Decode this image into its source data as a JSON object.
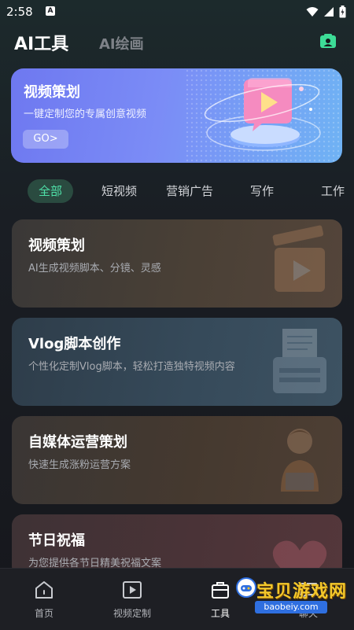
{
  "status_bar": {
    "time": "2:58",
    "notif_badge": "A"
  },
  "header": {
    "tabs": [
      {
        "label": "AI工具",
        "active": true
      },
      {
        "label": "AI绘画",
        "active": false
      }
    ]
  },
  "banner": {
    "title": "视频策划",
    "subtitle": "一键定制您的专属创意视频",
    "button_label": "GO>"
  },
  "categories": [
    {
      "label": "全部",
      "active": true
    },
    {
      "label": "短视频",
      "active": false
    },
    {
      "label": "营销广告",
      "active": false
    },
    {
      "label": "写作",
      "active": false
    },
    {
      "label": "工作",
      "active": false
    }
  ],
  "cards": [
    {
      "title": "视频策划",
      "desc": "AI生成视频脚本、分镜、灵感",
      "icon": "video-clapper-icon"
    },
    {
      "title": "Vlog脚本创作",
      "desc": "个性化定制Vlog脚本，轻松打造独特视频内容",
      "icon": "typewriter-icon"
    },
    {
      "title": "自媒体运营策划",
      "desc": "快速生成涨粉运营方案",
      "icon": "person-laptop-icon"
    },
    {
      "title": "节日祝福",
      "desc": "为您提供各节日精美祝福文案",
      "icon": "heart-icon"
    }
  ],
  "bottom_nav": [
    {
      "label": "首页",
      "icon": "home-icon",
      "active": false
    },
    {
      "label": "视频定制",
      "icon": "video-play-icon",
      "active": false
    },
    {
      "label": "工具",
      "icon": "toolbox-icon",
      "active": true
    },
    {
      "label": "聊天",
      "icon": "chat-icon",
      "active": false
    }
  ],
  "watermark": {
    "text": "宝贝游戏网",
    "url": "baobeiy.com"
  },
  "colors": {
    "accent_green": "#4fe0a8",
    "banner_start": "#6e78f0",
    "banner_end": "#6fb3f4",
    "background": "#1a1c22"
  }
}
